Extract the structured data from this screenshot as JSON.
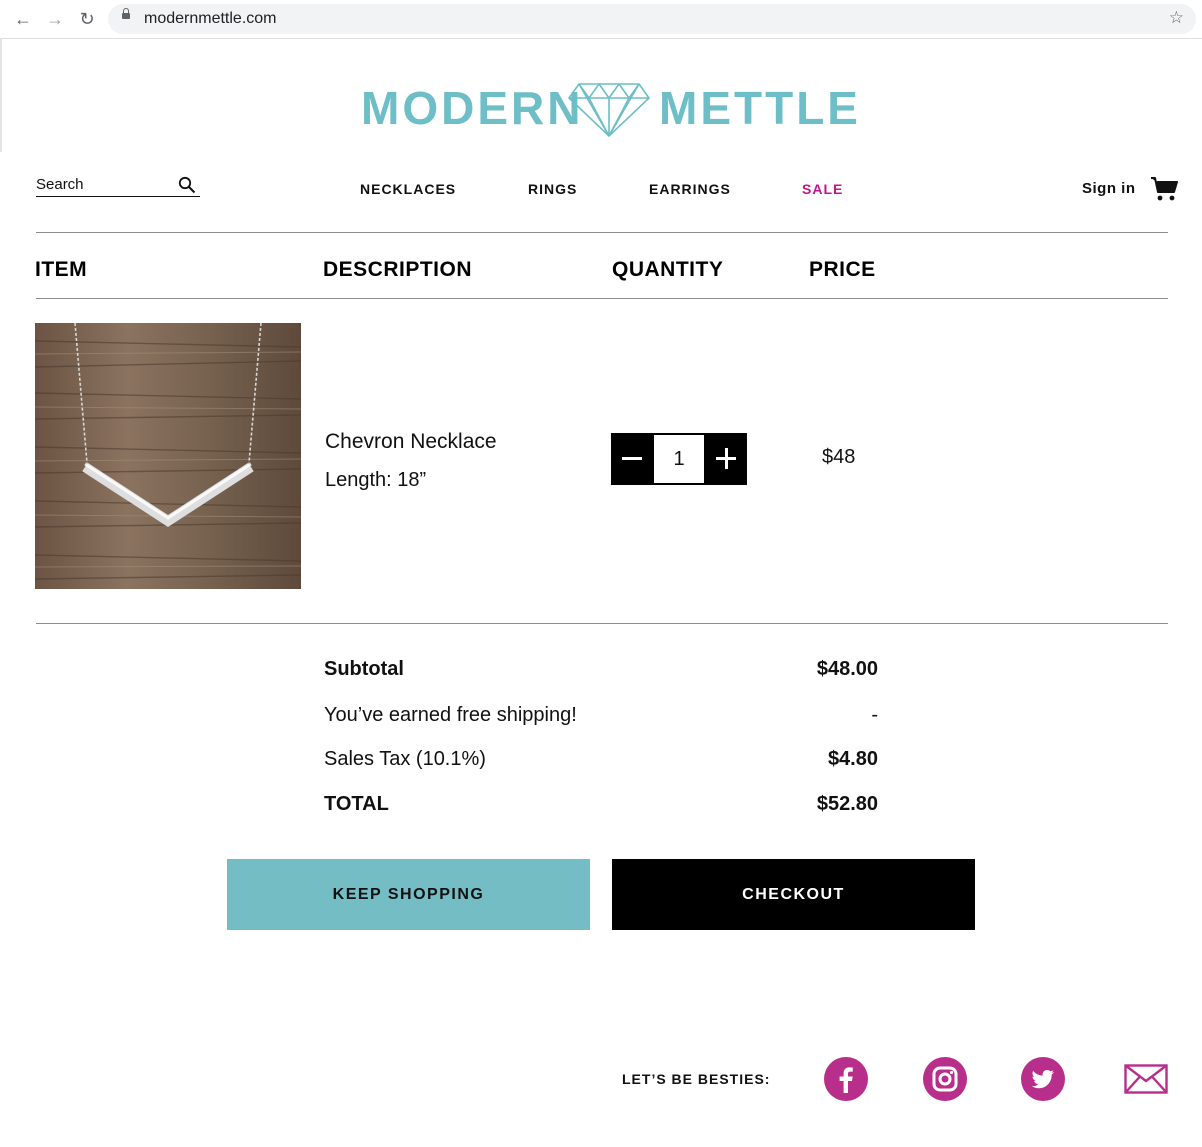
{
  "browser": {
    "url": "modernmettle.com"
  },
  "brand": {
    "word1": "MODERN",
    "word2": "METTLE",
    "accent_color": "#6dbec6",
    "sale_color": "#c0168f",
    "social_color": "#b72e8b"
  },
  "header": {
    "search_placeholder": "Search",
    "nav": {
      "necklaces": "NECKLACES",
      "rings": "RINGS",
      "earrings": "EARRINGS",
      "sale": "SALE"
    },
    "sign_in": "Sign in"
  },
  "cart": {
    "columns": {
      "item": "ITEM",
      "description": "DESCRIPTION",
      "quantity": "QUANTITY",
      "price": "PRICE"
    },
    "items": [
      {
        "name": "Chevron Necklace",
        "length": "Length: 18”",
        "quantity": "1",
        "price": "$48"
      }
    ]
  },
  "summary": {
    "subtotal_label": "Subtotal",
    "subtotal_value": "$48.00",
    "shipping_label": "You’ve earned free shipping!",
    "shipping_value": "-",
    "tax_label": "Sales Tax (10.1%)",
    "tax_value": "$4.80",
    "total_label": "TOTAL",
    "total_value": "$52.80"
  },
  "actions": {
    "keep_shopping": "KEEP SHOPPING",
    "checkout": "CHECKOUT"
  },
  "footer": {
    "besties": "LET’S BE BESTIES:",
    "icons": [
      "facebook-icon",
      "instagram-icon",
      "twitter-icon",
      "mail-icon"
    ]
  }
}
